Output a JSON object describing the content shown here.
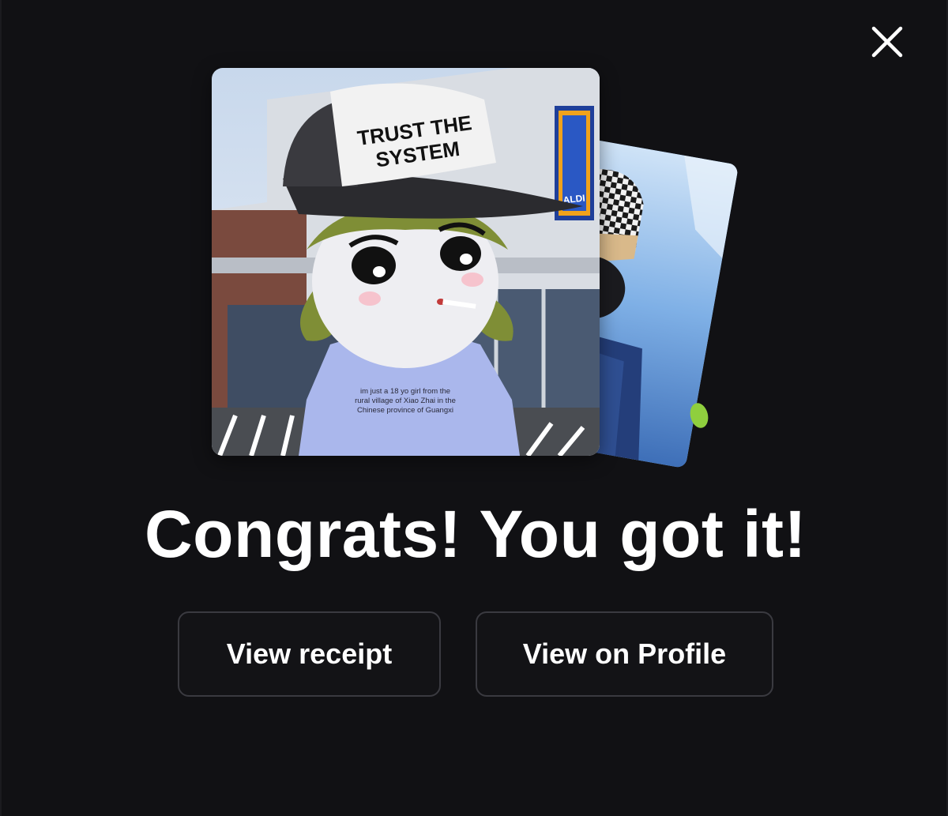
{
  "modal": {
    "headline": "Congrats! You got it!",
    "close_icon": "close-icon"
  },
  "nft_cards": {
    "front": {
      "cap_text_line1": "TRUST THE",
      "cap_text_line2": "SYSTEM",
      "store_sign": "ALDI",
      "shirt_text_line1": "im just a 18 yo girl from the",
      "shirt_text_line2": "rural village of Xiao Zhai in the",
      "shirt_text_line3": "Chinese province of Guangxi"
    }
  },
  "actions": {
    "receipt_label": "View receipt",
    "profile_label": "View on Profile"
  },
  "colors": {
    "background": "#111114",
    "button_border": "#3a3a40",
    "text": "#ffffff",
    "accent_dot": "#8fcf3e"
  }
}
